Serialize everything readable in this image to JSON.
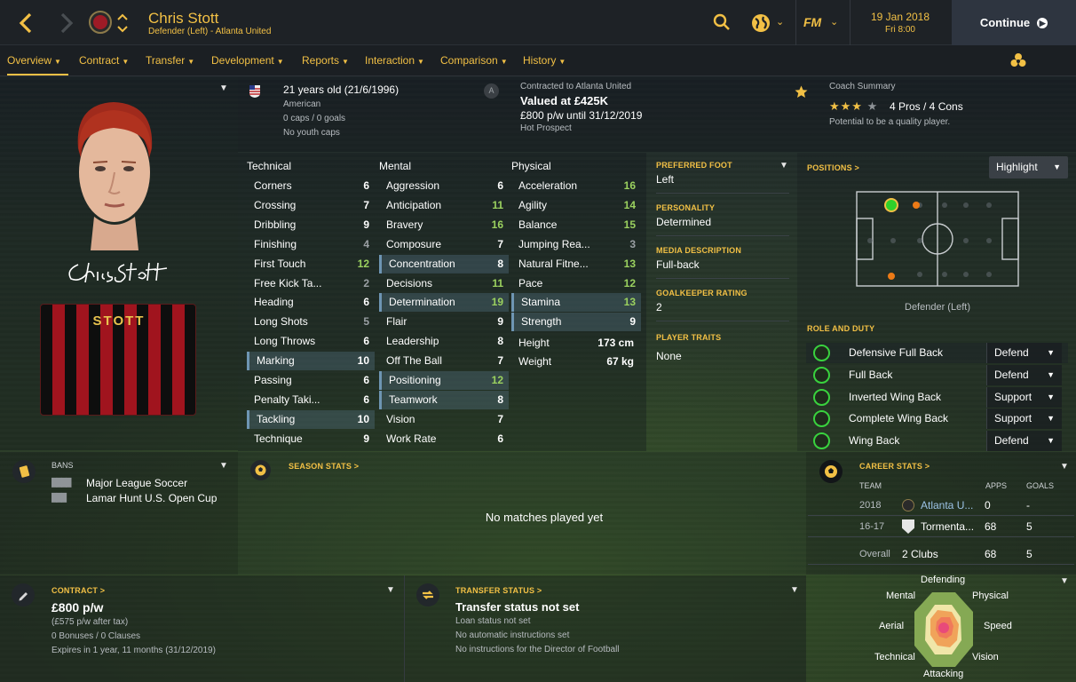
{
  "header": {
    "player_name": "Chris Stott",
    "subtitle": "Defender (Left) - Atlanta United",
    "date": "19 Jan 2018",
    "time": "Fri 8:00",
    "continue_label": "Continue",
    "fm_label": "FM"
  },
  "tabs": [
    {
      "label": "Overview"
    },
    {
      "label": "Contract"
    },
    {
      "label": "Transfer"
    },
    {
      "label": "Development"
    },
    {
      "label": "Reports"
    },
    {
      "label": "Interaction"
    },
    {
      "label": "Comparison"
    },
    {
      "label": "History"
    }
  ],
  "shirt": {
    "name": "STOTT"
  },
  "signature": "Chris Stott",
  "bio": {
    "age": "21 years old (21/6/1996)",
    "nationality": "American",
    "caps": "0 caps / 0 goals",
    "youth": "No youth caps"
  },
  "contract_summary": {
    "line1": "Contracted to Atlanta United",
    "value": "Valued at £425K",
    "wage": "£800 p/w until 31/12/2019",
    "tag": "Hot Prospect"
  },
  "coach": {
    "title": "Coach Summary",
    "stars": 3,
    "pros_cons": "4 Pros / 4 Cons",
    "note": "Potential to be a quality player."
  },
  "attributes": {
    "technical_title": "Technical",
    "mental_title": "Mental",
    "physical_title": "Physical",
    "technical": [
      {
        "name": "Corners",
        "value": "6"
      },
      {
        "name": "Crossing",
        "value": "7"
      },
      {
        "name": "Dribbling",
        "value": "9"
      },
      {
        "name": "Finishing",
        "value": "4"
      },
      {
        "name": "First Touch",
        "value": "12"
      },
      {
        "name": "Free Kick Ta...",
        "value": "2"
      },
      {
        "name": "Heading",
        "value": "6"
      },
      {
        "name": "Long Shots",
        "value": "5"
      },
      {
        "name": "Long Throws",
        "value": "6"
      },
      {
        "name": "Marking",
        "value": "10"
      },
      {
        "name": "Passing",
        "value": "6"
      },
      {
        "name": "Penalty Taki...",
        "value": "6"
      },
      {
        "name": "Tackling",
        "value": "10"
      },
      {
        "name": "Technique",
        "value": "9"
      }
    ],
    "mental": [
      {
        "name": "Aggression",
        "value": "6"
      },
      {
        "name": "Anticipation",
        "value": "11"
      },
      {
        "name": "Bravery",
        "value": "16"
      },
      {
        "name": "Composure",
        "value": "7"
      },
      {
        "name": "Concentration",
        "value": "8"
      },
      {
        "name": "Decisions",
        "value": "11"
      },
      {
        "name": "Determination",
        "value": "19"
      },
      {
        "name": "Flair",
        "value": "9"
      },
      {
        "name": "Leadership",
        "value": "8"
      },
      {
        "name": "Off The Ball",
        "value": "7"
      },
      {
        "name": "Positioning",
        "value": "12"
      },
      {
        "name": "Teamwork",
        "value": "8"
      },
      {
        "name": "Vision",
        "value": "7"
      },
      {
        "name": "Work Rate",
        "value": "6"
      }
    ],
    "physical": [
      {
        "name": "Acceleration",
        "value": "16"
      },
      {
        "name": "Agility",
        "value": "14"
      },
      {
        "name": "Balance",
        "value": "15"
      },
      {
        "name": "Jumping Rea...",
        "value": "3"
      },
      {
        "name": "Natural Fitne...",
        "value": "13"
      },
      {
        "name": "Pace",
        "value": "12"
      },
      {
        "name": "Stamina",
        "value": "13"
      },
      {
        "name": "Strength",
        "value": "9"
      }
    ],
    "height_label": "Height",
    "height": "173 cm",
    "weight_label": "Weight",
    "weight": "67 kg"
  },
  "info": {
    "foot_label": "PREFERRED FOOT",
    "foot": "Left",
    "personality_label": "PERSONALITY",
    "personality": "Determined",
    "media_label": "MEDIA DESCRIPTION",
    "media": "Full-back",
    "gk_label": "GOALKEEPER RATING",
    "gk": "2",
    "traits_label": "PLAYER TRAITS",
    "traits": "None"
  },
  "positions": {
    "title": "POSITIONS >",
    "highlight": "Highlight",
    "position_label": "Defender (Left)"
  },
  "roles": {
    "title": "ROLE AND DUTY",
    "items": [
      {
        "role": "Defensive Full Back",
        "duty": "Defend"
      },
      {
        "role": "Full Back",
        "duty": "Defend"
      },
      {
        "role": "Inverted Wing Back",
        "duty": "Support"
      },
      {
        "role": "Complete Wing Back",
        "duty": "Support"
      },
      {
        "role": "Wing Back",
        "duty": "Defend"
      }
    ]
  },
  "bans": {
    "title": "BANS",
    "items": [
      {
        "name": "Major League Soccer"
      },
      {
        "name": "Lamar Hunt U.S. Open Cup"
      }
    ]
  },
  "season": {
    "title": "SEASON STATS >",
    "empty": "No matches played yet"
  },
  "career": {
    "title": "CAREER STATS >",
    "col_team": "TEAM",
    "col_apps": "APPS",
    "col_goals": "GOALS",
    "rows": [
      {
        "year": "2018",
        "team": "Atlanta U...",
        "apps": "0",
        "goals": "-"
      },
      {
        "year": "16-17",
        "team": "Tormenta...",
        "apps": "68",
        "goals": "5"
      }
    ],
    "overall_label": "Overall",
    "overall_team": "2 Clubs",
    "overall_apps": "68",
    "overall_goals": "5"
  },
  "contract": {
    "title": "CONTRACT >",
    "wage": "£800 p/w",
    "after_tax": "(£575 p/w after tax)",
    "bonuses": "0 Bonuses / 0 Clauses",
    "expires": "Expires in 1 year, 11 months",
    "expires_date": "(31/12/2019)"
  },
  "transfer": {
    "title": "TRANSFER STATUS >",
    "status": "Transfer status not set",
    "loan": "Loan status not set",
    "auto": "No automatic instructions set",
    "director": "No instructions for the Director of Football"
  },
  "radar": {
    "labels": [
      "Defending",
      "Physical",
      "Speed",
      "Vision",
      "Attacking",
      "Technical",
      "Aerial",
      "Mental"
    ]
  },
  "colors": {
    "accent": "#f2c045",
    "green": "#9bd15f",
    "role_ring": "#39d23e"
  }
}
